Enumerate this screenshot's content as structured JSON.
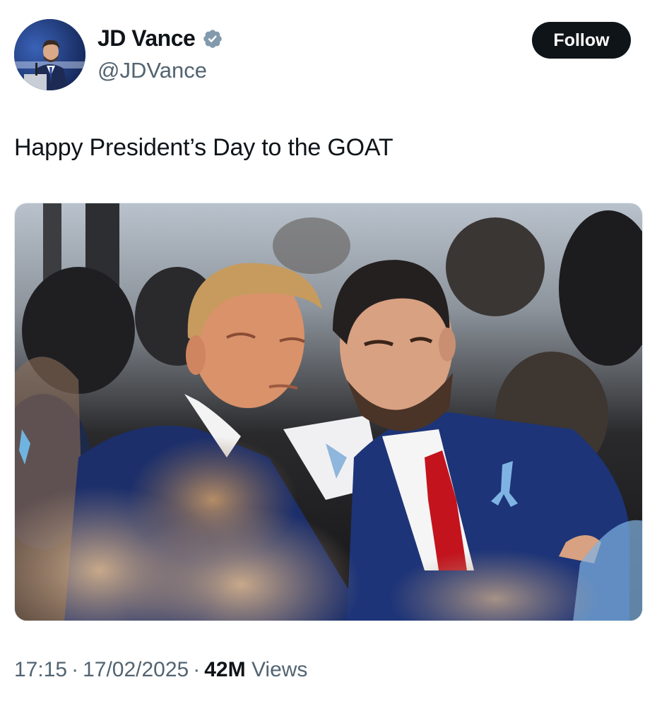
{
  "tweet": {
    "author": {
      "display_name": "JD Vance",
      "handle": "@JDVance",
      "verified_icon": "verified-badge-icon"
    },
    "follow_label": "Follow",
    "text": "Happy President’s Day to the GOAT",
    "meta": {
      "time": "17:15",
      "date": "17/02/2025",
      "views_count": "42M",
      "views_label": "Views",
      "separator": "·"
    }
  },
  "colors": {
    "text_primary": "#0f1419",
    "text_secondary": "#536471",
    "button_bg": "#0f1419",
    "badge": "#829aab"
  }
}
